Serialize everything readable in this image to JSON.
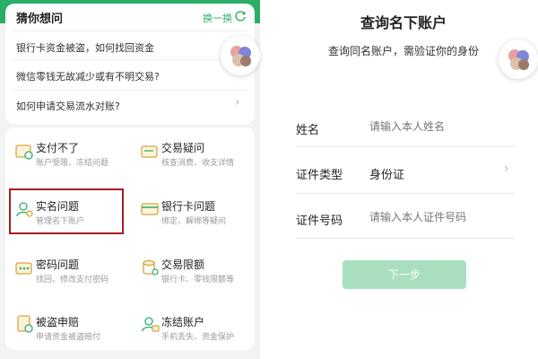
{
  "left": {
    "guess": {
      "title": "猜你想问",
      "refresh_label": "换一换",
      "questions": [
        "银行卡资金被盗，如何找回资金",
        "微信零钱无故减少或有不明交易?",
        "如何申请交易流水对账?"
      ]
    },
    "services": [
      {
        "title": "支付不了",
        "sub": "账户受限、冻结问题"
      },
      {
        "title": "交易疑问",
        "sub": "核查消费、收支详情"
      },
      {
        "title": "实名问题",
        "sub": "管理名下账户"
      },
      {
        "title": "银行卡问题",
        "sub": "绑定、解绑等疑问"
      },
      {
        "title": "密码问题",
        "sub": "找回、修改支付密码"
      },
      {
        "title": "交易限额",
        "sub": "银行卡、零钱限额等"
      },
      {
        "title": "被盗申赔",
        "sub": "申请资金被盗赔付"
      },
      {
        "title": "冻结账户",
        "sub": "手机丢失、资金保护"
      }
    ],
    "colors": {
      "accent": "#2aae67",
      "highlight_border": "#a51c20"
    }
  },
  "right": {
    "title": "查询名下账户",
    "subtitle": "查询同名账户，需验证你的身份",
    "fields": {
      "name": {
        "label": "姓名",
        "placeholder": "请输入本人姓名"
      },
      "id_type": {
        "label": "证件类型",
        "value": "身份证"
      },
      "id_number": {
        "label": "证件号码",
        "placeholder": "请输入本人证件号码"
      }
    },
    "next_label": "下一步"
  }
}
